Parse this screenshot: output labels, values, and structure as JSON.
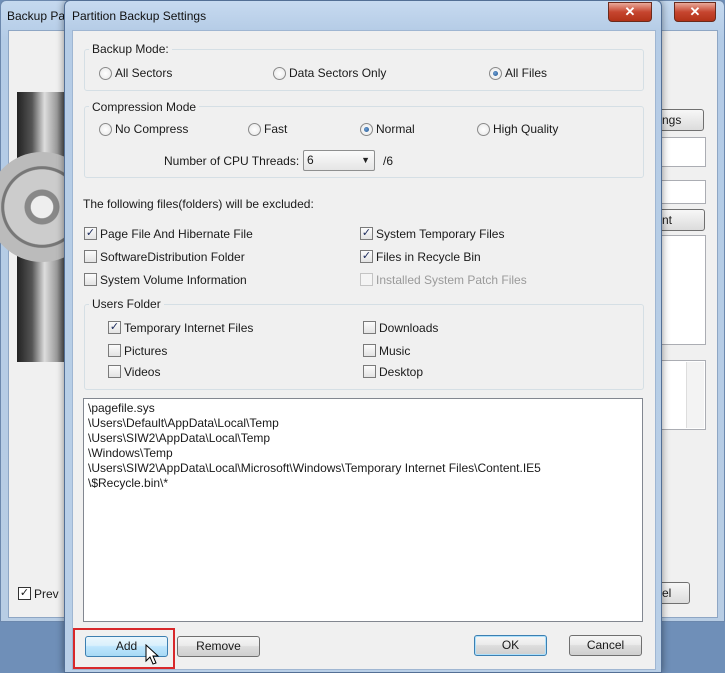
{
  "background_window": {
    "title": "Backup Pa",
    "close_glyph": "✕",
    "settings_button_fragment": "ngs",
    "edit_button_fragment": "nt",
    "cancel_button_fragment": "el",
    "preview_label": "Prev",
    "preview_checked": true
  },
  "dialog": {
    "title": "Partition Backup Settings",
    "close_glyph": "✕",
    "backup_mode": {
      "label": "Backup Mode:",
      "options": [
        "All Sectors",
        "Data Sectors Only",
        "All Files"
      ],
      "selected": "All Files"
    },
    "compression_mode": {
      "label": "Compression Mode",
      "options": [
        "No Compress",
        "Fast",
        "Normal",
        "High Quality"
      ],
      "selected": "Normal",
      "cpu_threads_label": "Number of CPU Threads:",
      "cpu_threads_value": "6",
      "cpu_threads_max": "/6"
    },
    "excluded_label": "The following files(folders) will be excluded:",
    "exclude_options": [
      {
        "label": "Page File And Hibernate File",
        "checked": true,
        "enabled": true
      },
      {
        "label": "System Temporary Files",
        "checked": true,
        "enabled": true
      },
      {
        "label": "SoftwareDistribution Folder",
        "checked": false,
        "enabled": true
      },
      {
        "label": "Files in Recycle Bin",
        "checked": true,
        "enabled": true
      },
      {
        "label": "System Volume Information",
        "checked": false,
        "enabled": true
      },
      {
        "label": "Installed System Patch Files",
        "checked": false,
        "enabled": false
      }
    ],
    "users_folder": {
      "label": "Users Folder",
      "items": [
        {
          "label": "Temporary Internet Files",
          "checked": true
        },
        {
          "label": "Downloads",
          "checked": false
        },
        {
          "label": "Pictures",
          "checked": false
        },
        {
          "label": "Music",
          "checked": false
        },
        {
          "label": "Videos",
          "checked": false
        },
        {
          "label": "Desktop",
          "checked": false
        }
      ]
    },
    "excluded_paths": [
      "\\pagefile.sys",
      "\\Users\\Default\\AppData\\Local\\Temp",
      "\\Users\\SIW2\\AppData\\Local\\Temp",
      "\\Windows\\Temp",
      "\\Users\\SIW2\\AppData\\Local\\Microsoft\\Windows\\Temporary Internet Files\\Content.IE5",
      "\\$Recycle.bin\\*"
    ],
    "buttons": {
      "add": "Add",
      "remove": "Remove",
      "ok": "OK",
      "cancel": "Cancel"
    }
  },
  "colors": {
    "highlight": "#d8282b",
    "title_bar": "#b9cfe7",
    "close_button": "#c6452f"
  }
}
